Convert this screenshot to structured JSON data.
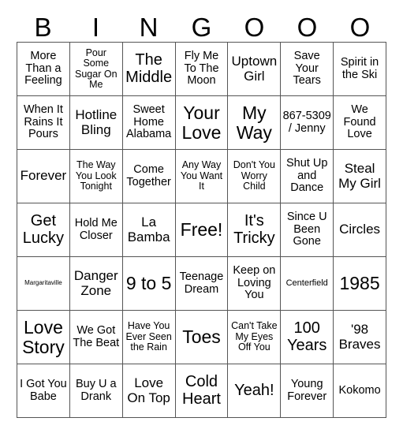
{
  "card": {
    "type": "bingo-card",
    "columns": 7,
    "rows": 7,
    "background_color": "#ffffff",
    "border_color": "#555555",
    "text_color": "#000000",
    "header_letters": [
      "B",
      "I",
      "N",
      "G",
      "O",
      "O",
      "O"
    ],
    "free_space_label": "Free!",
    "free_space_position": {
      "row": 4,
      "column": 4
    },
    "grid": [
      [
        {
          "text": "More Than a Feeling",
          "size": "md"
        },
        {
          "text": "Pour Some Sugar On Me",
          "size": "sm"
        },
        {
          "text": "The Middle",
          "size": "xl"
        },
        {
          "text": "Fly Me To The Moon",
          "size": "md"
        },
        {
          "text": "Uptown Girl",
          "size": "lg"
        },
        {
          "text": "Save Your Tears",
          "size": "md"
        },
        {
          "text": "Spirit in the Ski",
          "size": "md"
        }
      ],
      [
        {
          "text": "When It Rains It Pours",
          "size": "md"
        },
        {
          "text": "Hotline Bling",
          "size": "lg"
        },
        {
          "text": "Sweet Home Alabama",
          "size": "md"
        },
        {
          "text": "Your Love",
          "size": "xxl"
        },
        {
          "text": "My Way",
          "size": "xxl"
        },
        {
          "text": "867-5309 / Jenny",
          "size": "md"
        },
        {
          "text": "We Found Love",
          "size": "md"
        }
      ],
      [
        {
          "text": "Forever",
          "size": "lg"
        },
        {
          "text": "The Way You Look Tonight",
          "size": "sm"
        },
        {
          "text": "Come Together",
          "size": "md"
        },
        {
          "text": "Any Way You Want It",
          "size": "sm"
        },
        {
          "text": "Don't You Worry Child",
          "size": "sm"
        },
        {
          "text": "Shut Up and Dance",
          "size": "md"
        },
        {
          "text": "Steal My Girl",
          "size": "lg"
        }
      ],
      [
        {
          "text": "Get Lucky",
          "size": "xl"
        },
        {
          "text": "Hold Me Closer",
          "size": "md"
        },
        {
          "text": "La Bamba",
          "size": "lg"
        },
        {
          "text": "Free!",
          "size": "xxl"
        },
        {
          "text": "It's Tricky",
          "size": "xl"
        },
        {
          "text": "Since U Been Gone",
          "size": "md"
        },
        {
          "text": "Circles",
          "size": "lg"
        }
      ],
      [
        {
          "text": "Margaritaville",
          "size": "xxs"
        },
        {
          "text": "Danger Zone",
          "size": "lg"
        },
        {
          "text": "9 to 5",
          "size": "xxl"
        },
        {
          "text": "Teenage Dream",
          "size": "md"
        },
        {
          "text": "Keep on Loving You",
          "size": "md"
        },
        {
          "text": "Centerfield",
          "size": "xs"
        },
        {
          "text": "1985",
          "size": "xxl"
        }
      ],
      [
        {
          "text": "Love Story",
          "size": "xxl"
        },
        {
          "text": "We Got The Beat",
          "size": "md"
        },
        {
          "text": "Have You Ever Seen the Rain",
          "size": "sm"
        },
        {
          "text": "Toes",
          "size": "xxl"
        },
        {
          "text": "Can't Take My Eyes Off You",
          "size": "sm"
        },
        {
          "text": "100 Years",
          "size": "xl"
        },
        {
          "text": "'98 Braves",
          "size": "lg"
        }
      ],
      [
        {
          "text": "I Got You Babe",
          "size": "md"
        },
        {
          "text": "Buy U a Drank",
          "size": "md"
        },
        {
          "text": "Love On Top",
          "size": "lg"
        },
        {
          "text": "Cold Heart",
          "size": "xl"
        },
        {
          "text": "Yeah!",
          "size": "xl"
        },
        {
          "text": "Young Forever",
          "size": "md"
        },
        {
          "text": "Kokomo",
          "size": "md"
        }
      ]
    ]
  }
}
